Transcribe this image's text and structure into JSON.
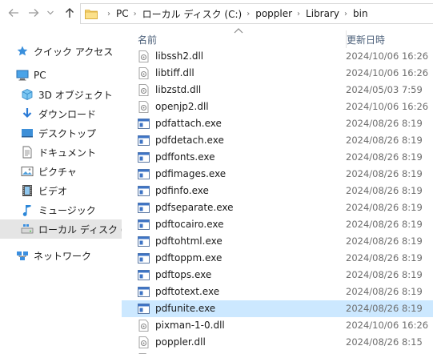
{
  "address": {
    "crumbs": [
      "PC",
      "ローカル ディスク (C:)",
      "poppler",
      "Library",
      "bin"
    ]
  },
  "nav": {
    "items": [
      {
        "label": "クイック アクセス",
        "icon": "star-icon"
      },
      {
        "label": "PC",
        "icon": "pc-icon"
      },
      {
        "label": "3D オブジェクト",
        "icon": "3d-objects-icon"
      },
      {
        "label": "ダウンロード",
        "icon": "download-icon"
      },
      {
        "label": "デスクトップ",
        "icon": "desktop-icon"
      },
      {
        "label": "ドキュメント",
        "icon": "documents-icon"
      },
      {
        "label": "ピクチャ",
        "icon": "pictures-icon"
      },
      {
        "label": "ビデオ",
        "icon": "videos-icon"
      },
      {
        "label": "ミュージック",
        "icon": "music-icon"
      },
      {
        "label": "ローカル ディスク (C:)",
        "icon": "local-disk-icon"
      },
      {
        "label": "ネットワーク",
        "icon": "network-icon"
      }
    ]
  },
  "columns": {
    "name": "名前",
    "date": "更新日時"
  },
  "files": [
    {
      "name": "libssh2.dll",
      "date": "2024/10/06 16:26",
      "type": "dll"
    },
    {
      "name": "libtiff.dll",
      "date": "2024/10/06 16:26",
      "type": "dll"
    },
    {
      "name": "libzstd.dll",
      "date": "2024/05/03 7:59",
      "type": "dll"
    },
    {
      "name": "openjp2.dll",
      "date": "2024/10/06 16:26",
      "type": "dll"
    },
    {
      "name": "pdfattach.exe",
      "date": "2024/08/26 8:19",
      "type": "exe"
    },
    {
      "name": "pdfdetach.exe",
      "date": "2024/08/26 8:19",
      "type": "exe"
    },
    {
      "name": "pdffonts.exe",
      "date": "2024/08/26 8:19",
      "type": "exe"
    },
    {
      "name": "pdfimages.exe",
      "date": "2024/08/26 8:19",
      "type": "exe"
    },
    {
      "name": "pdfinfo.exe",
      "date": "2024/08/26 8:19",
      "type": "exe"
    },
    {
      "name": "pdfseparate.exe",
      "date": "2024/08/26 8:19",
      "type": "exe"
    },
    {
      "name": "pdftocairo.exe",
      "date": "2024/08/26 8:19",
      "type": "exe"
    },
    {
      "name": "pdftohtml.exe",
      "date": "2024/08/26 8:19",
      "type": "exe"
    },
    {
      "name": "pdftoppm.exe",
      "date": "2024/08/26 8:19",
      "type": "exe"
    },
    {
      "name": "pdftops.exe",
      "date": "2024/08/26 8:19",
      "type": "exe"
    },
    {
      "name": "pdftotext.exe",
      "date": "2024/08/26 8:19",
      "type": "exe"
    },
    {
      "name": "pdfunite.exe",
      "date": "2024/08/26 8:19",
      "type": "exe",
      "selected": true
    },
    {
      "name": "pixman-1-0.dll",
      "date": "2024/10/06 16:26",
      "type": "dll"
    },
    {
      "name": "poppler.dll",
      "date": "2024/08/26 8:15",
      "type": "dll"
    },
    {
      "name": "",
      "date": "",
      "type": "dll"
    }
  ],
  "colors": {
    "selection": "#cce8ff",
    "nav_selected": "#e5e5e5",
    "header_text": "#4c607a",
    "folder": "#f4c430"
  }
}
